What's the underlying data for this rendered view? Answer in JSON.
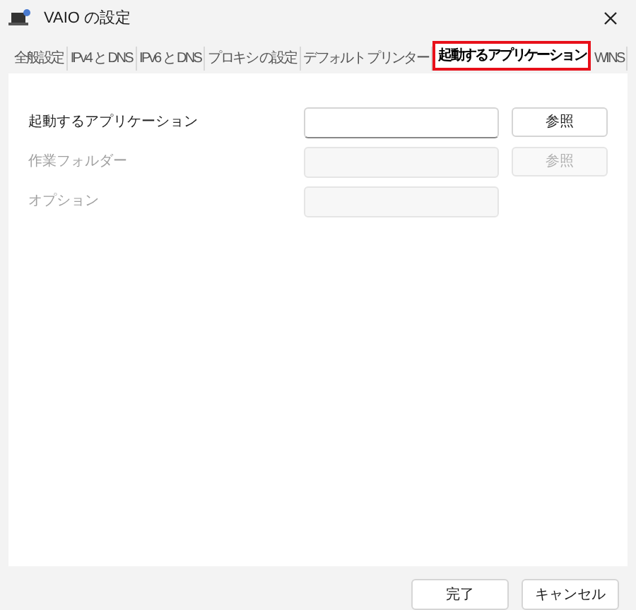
{
  "window": {
    "title": "VAIO の設定"
  },
  "tabs": [
    {
      "label": "全般設定",
      "selected": false
    },
    {
      "label": "IPv4 と DNS",
      "selected": false
    },
    {
      "label": "IPv6 と DNS",
      "selected": false
    },
    {
      "label": "プロキシ の設定",
      "selected": false
    },
    {
      "label": "デフォルト プリンター",
      "selected": false
    },
    {
      "label": "起動するアプリケーション",
      "selected": true
    },
    {
      "label": "WINS",
      "selected": false
    }
  ],
  "fields": [
    {
      "label": "起動するアプリケーション",
      "disabled": false,
      "button": "参照"
    },
    {
      "label": "作業フォルダー",
      "disabled": true,
      "button": "参照"
    },
    {
      "label": "オプション",
      "disabled": true
    }
  ],
  "buttons": [
    "完了",
    "キャンセル"
  ]
}
